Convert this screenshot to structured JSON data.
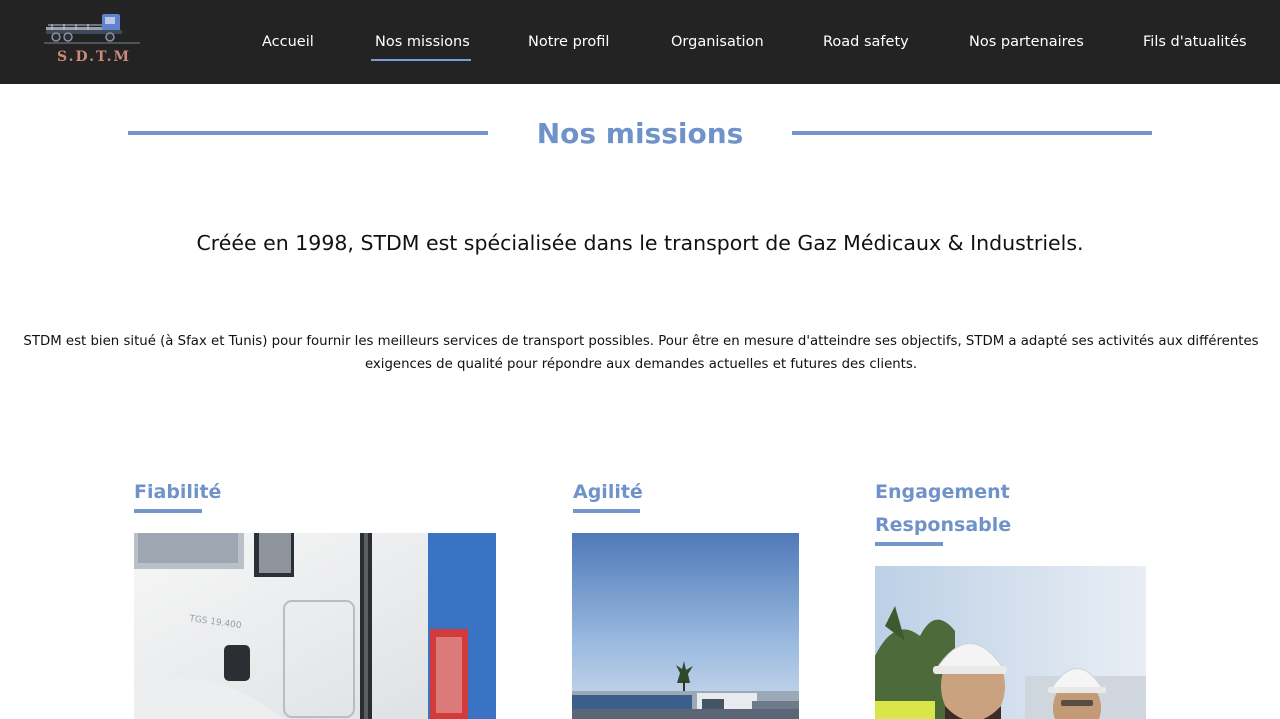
{
  "nav": {
    "logo_text": "S.D.T.M",
    "items": [
      {
        "label": "Accueil"
      },
      {
        "label": "Nos missions",
        "active": true
      },
      {
        "label": "Notre profil"
      },
      {
        "label": "Organisation"
      },
      {
        "label": "Road safety"
      },
      {
        "label": "Nos partenaires"
      },
      {
        "label": "Fils d'atualités"
      }
    ]
  },
  "main": {
    "title": "Nos missions",
    "lead": "Créée en 1998, STDM est spécialisée dans le transport de Gaz Médicaux & Industriels.",
    "paragraph": "STDM est bien situé (à Sfax et Tunis) pour fournir les meilleurs services de transport possibles. Pour être en mesure d'atteindre ses objectifs, STDM a adapté ses activités aux différentes exigences de qualité pour répondre aux demandes actuelles et futures des clients."
  },
  "cards": [
    {
      "title": "Fiabilité",
      "image": "truck-cab-photo"
    },
    {
      "title": "Agilité",
      "image": "truck-fleet-photo"
    },
    {
      "title": "Engagement Responsable",
      "image": "engineers-photo"
    }
  ],
  "colors": {
    "nav_bg": "#232323",
    "accent": "#6f93c9",
    "rule": "#7496cc",
    "active_underline": "#7a9fd6",
    "logo_text": "#c98a78"
  }
}
